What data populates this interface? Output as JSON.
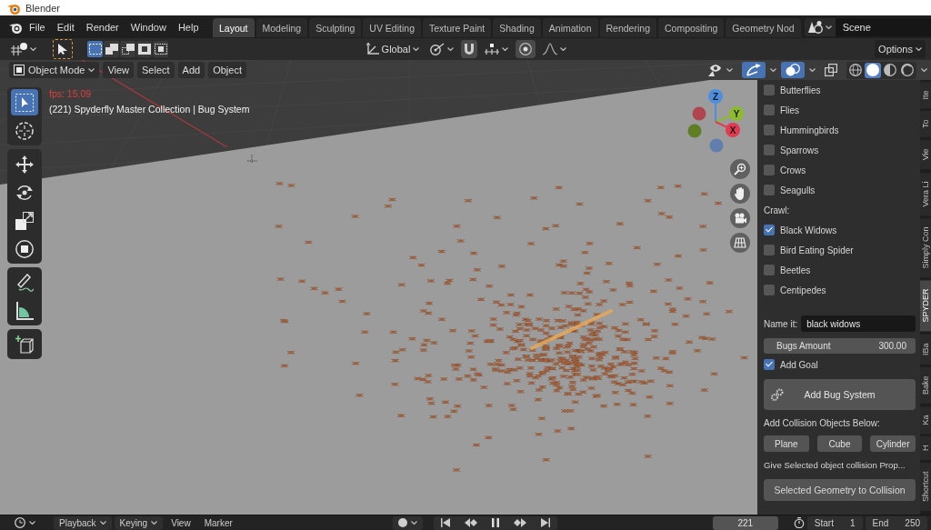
{
  "window": {
    "title": "Blender"
  },
  "menu_bar": {
    "menus": [
      "File",
      "Edit",
      "Render",
      "Window",
      "Help"
    ],
    "workspace_tabs": [
      {
        "label": "Layout",
        "selected": true
      },
      {
        "label": "Modeling",
        "selected": false
      },
      {
        "label": "Sculpting",
        "selected": false
      },
      {
        "label": "UV Editing",
        "selected": false
      },
      {
        "label": "Texture Paint",
        "selected": false
      },
      {
        "label": "Shading",
        "selected": false
      },
      {
        "label": "Animation",
        "selected": false
      },
      {
        "label": "Rendering",
        "selected": false
      },
      {
        "label": "Compositing",
        "selected": false
      },
      {
        "label": "Geometry Nod",
        "selected": false
      }
    ],
    "scene": "Scene"
  },
  "tool_header": {
    "select_modes": [
      {
        "kind": "set",
        "selected": true
      },
      {
        "kind": "extend",
        "selected": false
      },
      {
        "kind": "subtract",
        "selected": false
      },
      {
        "kind": "invert",
        "selected": false
      },
      {
        "kind": "intersect",
        "selected": false
      }
    ],
    "orientation": "Global",
    "options": "Options"
  },
  "viewport_header": {
    "mode": "Object Mode",
    "menus": [
      "View",
      "Select",
      "Add",
      "Object"
    ],
    "gizmos_on": true,
    "overlays_on": true,
    "xray_on": false,
    "shading_modes": [
      {
        "kind": "wireframe",
        "selected": false
      },
      {
        "kind": "solid",
        "selected": true
      },
      {
        "kind": "material",
        "selected": false
      },
      {
        "kind": "rendered",
        "selected": false
      }
    ]
  },
  "toolbar": {
    "groups": [
      {
        "tools": [
          {
            "kind": "select-box",
            "selected": true
          },
          {
            "kind": "cursor",
            "selected": false
          }
        ]
      },
      {
        "tools": [
          {
            "kind": "move",
            "selected": false
          },
          {
            "kind": "rotate",
            "selected": false
          },
          {
            "kind": "scale",
            "selected": false
          },
          {
            "kind": "transform",
            "selected": false
          }
        ]
      },
      {
        "tools": [
          {
            "kind": "annotate",
            "selected": false
          },
          {
            "kind": "measure",
            "selected": false
          }
        ]
      },
      {
        "tools": [
          {
            "kind": "add-cube",
            "selected": false
          }
        ]
      }
    ]
  },
  "viewport": {
    "fps": "fps: 15.09",
    "info": "(221) Spyderfly Master Collection | Bug System",
    "axes": [
      {
        "kind": "positive",
        "label": "Z",
        "color": "#4c8ee0"
      },
      {
        "kind": "positive",
        "label": "Y",
        "color": "#8cbb2c"
      },
      {
        "kind": "positive",
        "label": "X",
        "color": "#e33a50"
      },
      {
        "kind": "negative",
        "color": "#b04550"
      },
      {
        "kind": "negative",
        "color": "#5f7f24"
      },
      {
        "kind": "negative",
        "color": "#607fae"
      }
    ]
  },
  "sidebar": {
    "items": [
      {
        "kind": "checkbox",
        "label": "Butterflies",
        "checked": false
      },
      {
        "kind": "checkbox",
        "label": "Flies",
        "checked": false
      },
      {
        "kind": "checkbox",
        "label": "Hummingbirds",
        "checked": false
      },
      {
        "kind": "checkbox",
        "label": "Sparrows",
        "checked": false
      },
      {
        "kind": "checkbox",
        "label": "Crows",
        "checked": false
      },
      {
        "kind": "checkbox",
        "label": "Seagulls",
        "checked": false
      },
      {
        "kind": "heading",
        "label": "Crawl:"
      },
      {
        "kind": "checkbox",
        "label": "Black Widows",
        "checked": true
      },
      {
        "kind": "checkbox",
        "label": "Bird Eating Spider",
        "checked": false
      },
      {
        "kind": "checkbox",
        "label": "Beetles",
        "checked": false
      },
      {
        "kind": "checkbox",
        "label": "Centipedes",
        "checked": false
      }
    ],
    "name_label": "Name it:",
    "name_value": "black widows",
    "amount": {
      "label": "Bugs Amount",
      "value": "300.00"
    },
    "add_goal": {
      "label": "Add Goal",
      "checked": true
    },
    "add_button": "Add Bug System",
    "collision_heading": "Add Collision Objects Below:",
    "collision_buttons": [
      "Plane",
      "Cube",
      "Cylinder"
    ],
    "collision_hint": "Give Selected object collision Prop...",
    "collision_button": "Selected Geometry to Collision",
    "tabs": [
      {
        "label": "Ite",
        "selected": false
      },
      {
        "label": "To",
        "selected": false
      },
      {
        "label": "Vie",
        "selected": false
      },
      {
        "label": "Vera Li",
        "selected": false
      },
      {
        "label": "Simply Con",
        "selected": false
      },
      {
        "label": "SPYDER",
        "selected": true
      },
      {
        "label": "IBa",
        "selected": false
      },
      {
        "label": "Bake",
        "selected": false
      },
      {
        "label": "Ka",
        "selected": false
      },
      {
        "label": "H",
        "selected": false
      },
      {
        "label": "Shortcut",
        "selected": false
      }
    ]
  },
  "timeline": {
    "menus": [
      {
        "kind": "dropdown",
        "label": "Playback"
      },
      {
        "kind": "dropdown",
        "label": "Keying"
      },
      {
        "kind": "menu",
        "label": "View"
      },
      {
        "kind": "menu",
        "label": "Marker"
      }
    ],
    "record_on": false,
    "playing": true,
    "current_frame": "221",
    "start_label": "Start",
    "start": "1",
    "end_label": "End",
    "end": "250"
  }
}
